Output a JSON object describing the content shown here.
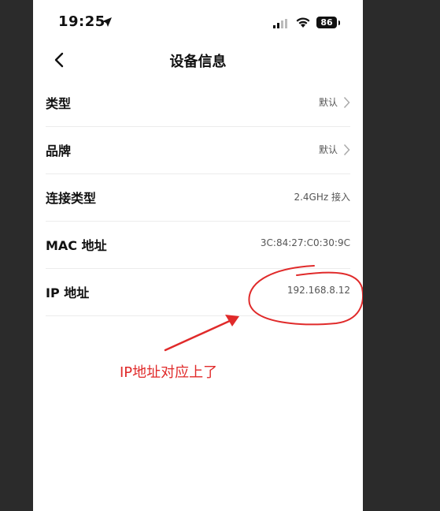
{
  "status_bar": {
    "time": "19:25",
    "battery": "86"
  },
  "nav": {
    "title": "设备信息"
  },
  "rows": [
    {
      "label": "类型",
      "value": "默认"
    },
    {
      "label": "品牌",
      "value": "默认"
    },
    {
      "label": "连接类型",
      "value": "2.4GHz 接入"
    },
    {
      "label": "MAC 地址",
      "value": "3C:84:27:C0:30:9C"
    },
    {
      "label": "IP 地址",
      "value": "192.168.8.12"
    }
  ],
  "annotation": {
    "text": "IP地址对应上了",
    "color": "#e02a2a"
  },
  "icons": {
    "back": "chevron-left-icon",
    "chevron": "chevron-right-icon",
    "location": "location-arrow-icon",
    "signal": "cellular-signal-icon",
    "wifi": "wifi-icon",
    "battery": "battery-icon"
  }
}
